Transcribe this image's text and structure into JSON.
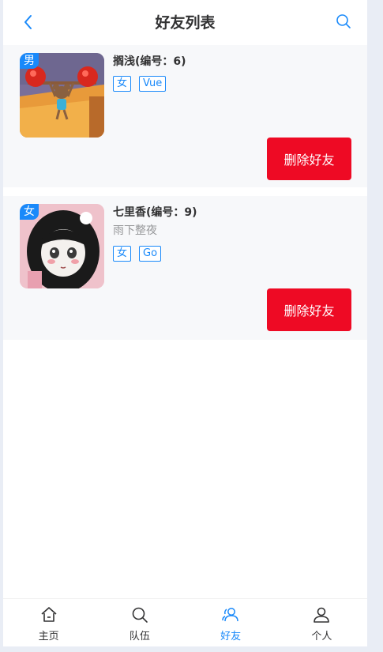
{
  "header": {
    "title": "好友列表",
    "back_icon": "chevron-left-icon",
    "search_icon": "search-icon",
    "accent": "#1989fa"
  },
  "friends": [
    {
      "name": "搁浅(编号：6)",
      "gender_badge": "男",
      "profile": "",
      "tags": [
        "女",
        "Vue"
      ],
      "delete_label": "删除好友",
      "avatar": "cartoon-mouse-lifting-tomatoes"
    },
    {
      "name": "七里香(编号：9)",
      "gender_badge": "女",
      "profile": "雨下整夜",
      "tags": [
        "女",
        "Go"
      ],
      "delete_label": "删除好友",
      "avatar": "anime-girl-portrait"
    }
  ],
  "tabbar": {
    "items": [
      {
        "label": "主页",
        "icon": "home-icon"
      },
      {
        "label": "队伍",
        "icon": "search-icon"
      },
      {
        "label": "好友",
        "icon": "friends-icon"
      },
      {
        "label": "个人",
        "icon": "user-icon"
      }
    ],
    "active": "好友"
  },
  "colors": {
    "danger": "#ee0a24",
    "primary": "#1989fa",
    "card_bg": "#f7f8fa"
  }
}
